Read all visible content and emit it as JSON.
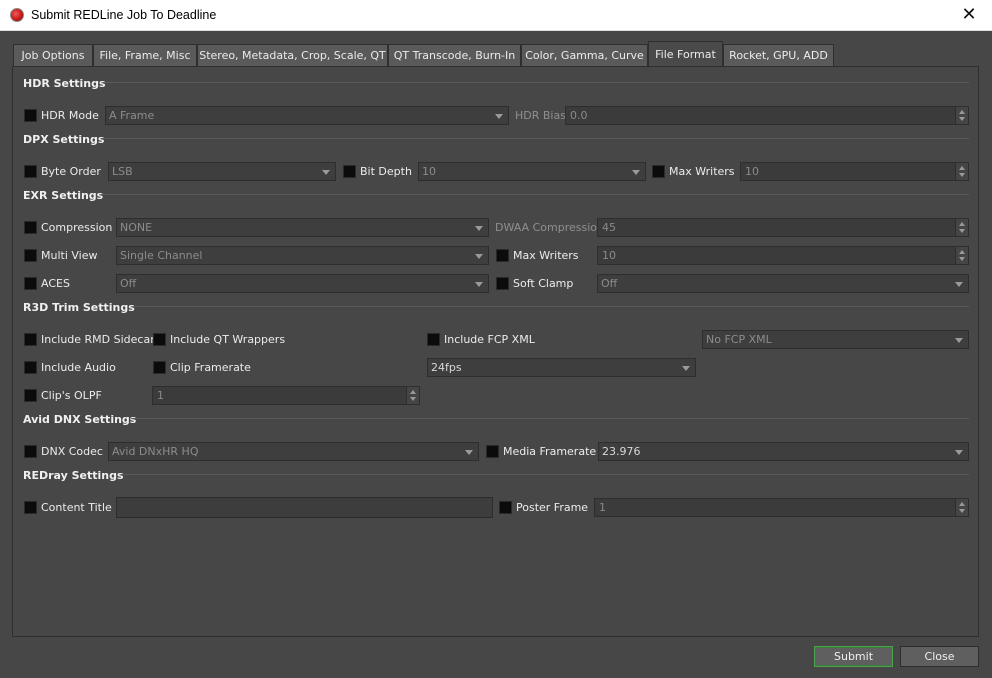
{
  "window": {
    "title": "Submit REDLine Job To Deadline",
    "close_glyph": "✕"
  },
  "tabs": [
    "Job Options",
    "File, Frame, Misc",
    "Stereo, Metadata, Crop, Scale, QT",
    "QT Transcode, Burn-In",
    "Color, Gamma, Curve",
    "File Format",
    "Rocket, GPU, ADD"
  ],
  "active_tab": "File Format",
  "hdr": {
    "title": "HDR Settings",
    "hdr_mode_label": "HDR Mode",
    "hdr_mode_value": "A Frame",
    "hdr_bias_label": "HDR Bias",
    "hdr_bias_value": "0.0"
  },
  "dpx": {
    "title": "DPX Settings",
    "byte_order_label": "Byte Order",
    "byte_order_value": "LSB",
    "bit_depth_label": "Bit Depth",
    "bit_depth_value": "10",
    "max_writers_label": "Max Writers",
    "max_writers_value": "10"
  },
  "exr": {
    "title": "EXR Settings",
    "compression_label": "Compression",
    "compression_value": "NONE",
    "dwaa_label": "DWAA Compression",
    "dwaa_value": "45",
    "multi_view_label": "Multi View",
    "multi_view_value": "Single Channel",
    "max_writers_label": "Max Writers",
    "max_writers_value": "10",
    "aces_label": "ACES",
    "aces_value": "Off",
    "soft_clamp_label": "Soft Clamp",
    "soft_clamp_value": "Off"
  },
  "r3d": {
    "title": "R3D Trim Settings",
    "include_rmd_label": "Include RMD Sidecar",
    "include_qt_label": "Include QT Wrappers",
    "include_fcp_label": "Include FCP XML",
    "fcp_value": "No FCP XML",
    "include_audio_label": "Include Audio",
    "clip_framerate_label": "Clip Framerate",
    "clip_framerate_value": "24fps",
    "clip_olpf_label": "Clip's OLPF",
    "clip_olpf_value": "1"
  },
  "dnx": {
    "title": "Avid DNX Settings",
    "codec_label": "DNX Codec",
    "codec_value": "Avid DNxHR HQ",
    "media_framerate_label": "Media Framerate",
    "media_framerate_value": "23.976"
  },
  "redray": {
    "title": "REDray Settings",
    "content_title_label": "Content Title",
    "content_title_value": "",
    "poster_frame_label": "Poster Frame",
    "poster_frame_value": "1"
  },
  "buttons": {
    "submit": "Submit",
    "close": "Close"
  }
}
